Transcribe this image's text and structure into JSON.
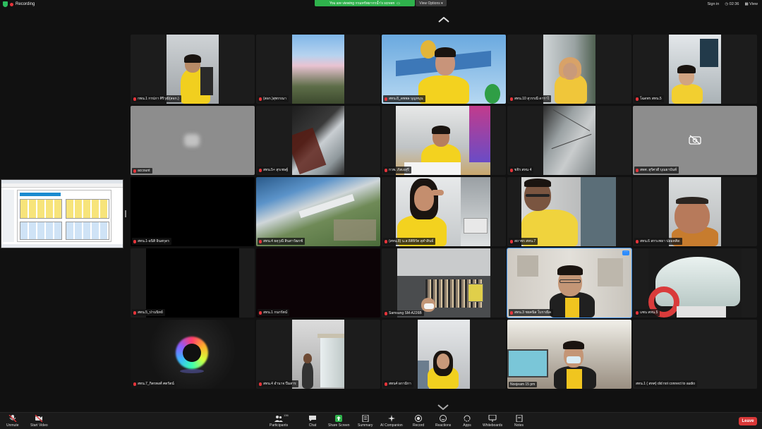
{
  "top_bar": {
    "recording_label": "Recording",
    "viewing_banner": "You are viewing กรมทรัพยากรน้ำ's screen",
    "view_options": "View Options",
    "sign_in": "Sign in",
    "clock": "02:36",
    "view": "View"
  },
  "participants": [
    {
      "name": "กพน.1 กรปภา ศิริวุฒิ(สอก.)"
    },
    {
      "name": "(สอก.)สุพรรณา"
    },
    {
      "name": "สทน.8_ดพพล บุญหนุน"
    },
    {
      "name": "สทน.10 สุวรรณี ดาราไ"
    },
    {
      "name": "โฉดพร สทน.5"
    },
    {
      "name": "account"
    },
    {
      "name": "สทน.5+ สุรเชษฐ์"
    },
    {
      "name": "กวพ. ภัสเอสุรี"
    },
    {
      "name": "ขจิร สทน 4"
    },
    {
      "name": "สทศ. สุรัศวดี บุณยาบันท์"
    },
    {
      "name": "สทน.1-อนิสิ อินสกุดร"
    },
    {
      "name": "สทน.4 ยคุวุณี สินสาวัฒรชั"
    },
    {
      "name": "(สทน.8) น.ส.ธิติธิรัต สุคำสินธ์"
    },
    {
      "name": "สถาพร สทน.7"
    },
    {
      "name": "สทน.6 สกระพธา ปลอคคิด"
    },
    {
      "name": "สทน.5_ปานนิทย์"
    },
    {
      "name": "สทน.1 กนกรัตน์"
    },
    {
      "name": "Samsung SM-A226B"
    },
    {
      "name": "สทน.3 ชยคนิล โบราณิล"
    },
    {
      "name": "แซน สทน.5"
    },
    {
      "name": "สทน.7_กิตรพงศ์ ศตรัตน์"
    },
    {
      "name": "สทน.4 อำนาจ ปีมสาร"
    },
    {
      "name": "สทน4 ผกามิกา"
    },
    {
      "name": "Noojeam 15 pm"
    },
    {
      "name": "สทน.1 ( สทศ) did not connect to audio"
    }
  ],
  "toolbar": {
    "unmute": "Unmute",
    "start_video": "Start Video",
    "participants": "Participants",
    "participant_count": "136",
    "chat": "Chat",
    "share_screen": "Share Screen",
    "summary": "Summary",
    "ai_companion": "AI Companion",
    "record": "Record",
    "reactions": "Reactions",
    "apps": "Apps",
    "whiteboards": "Whiteboards",
    "notes": "Notes",
    "leave": "Leave"
  },
  "colors": {
    "share_green": "#2fb24c",
    "leave_red": "#d93838",
    "accent_blue": "#2d8cff"
  }
}
